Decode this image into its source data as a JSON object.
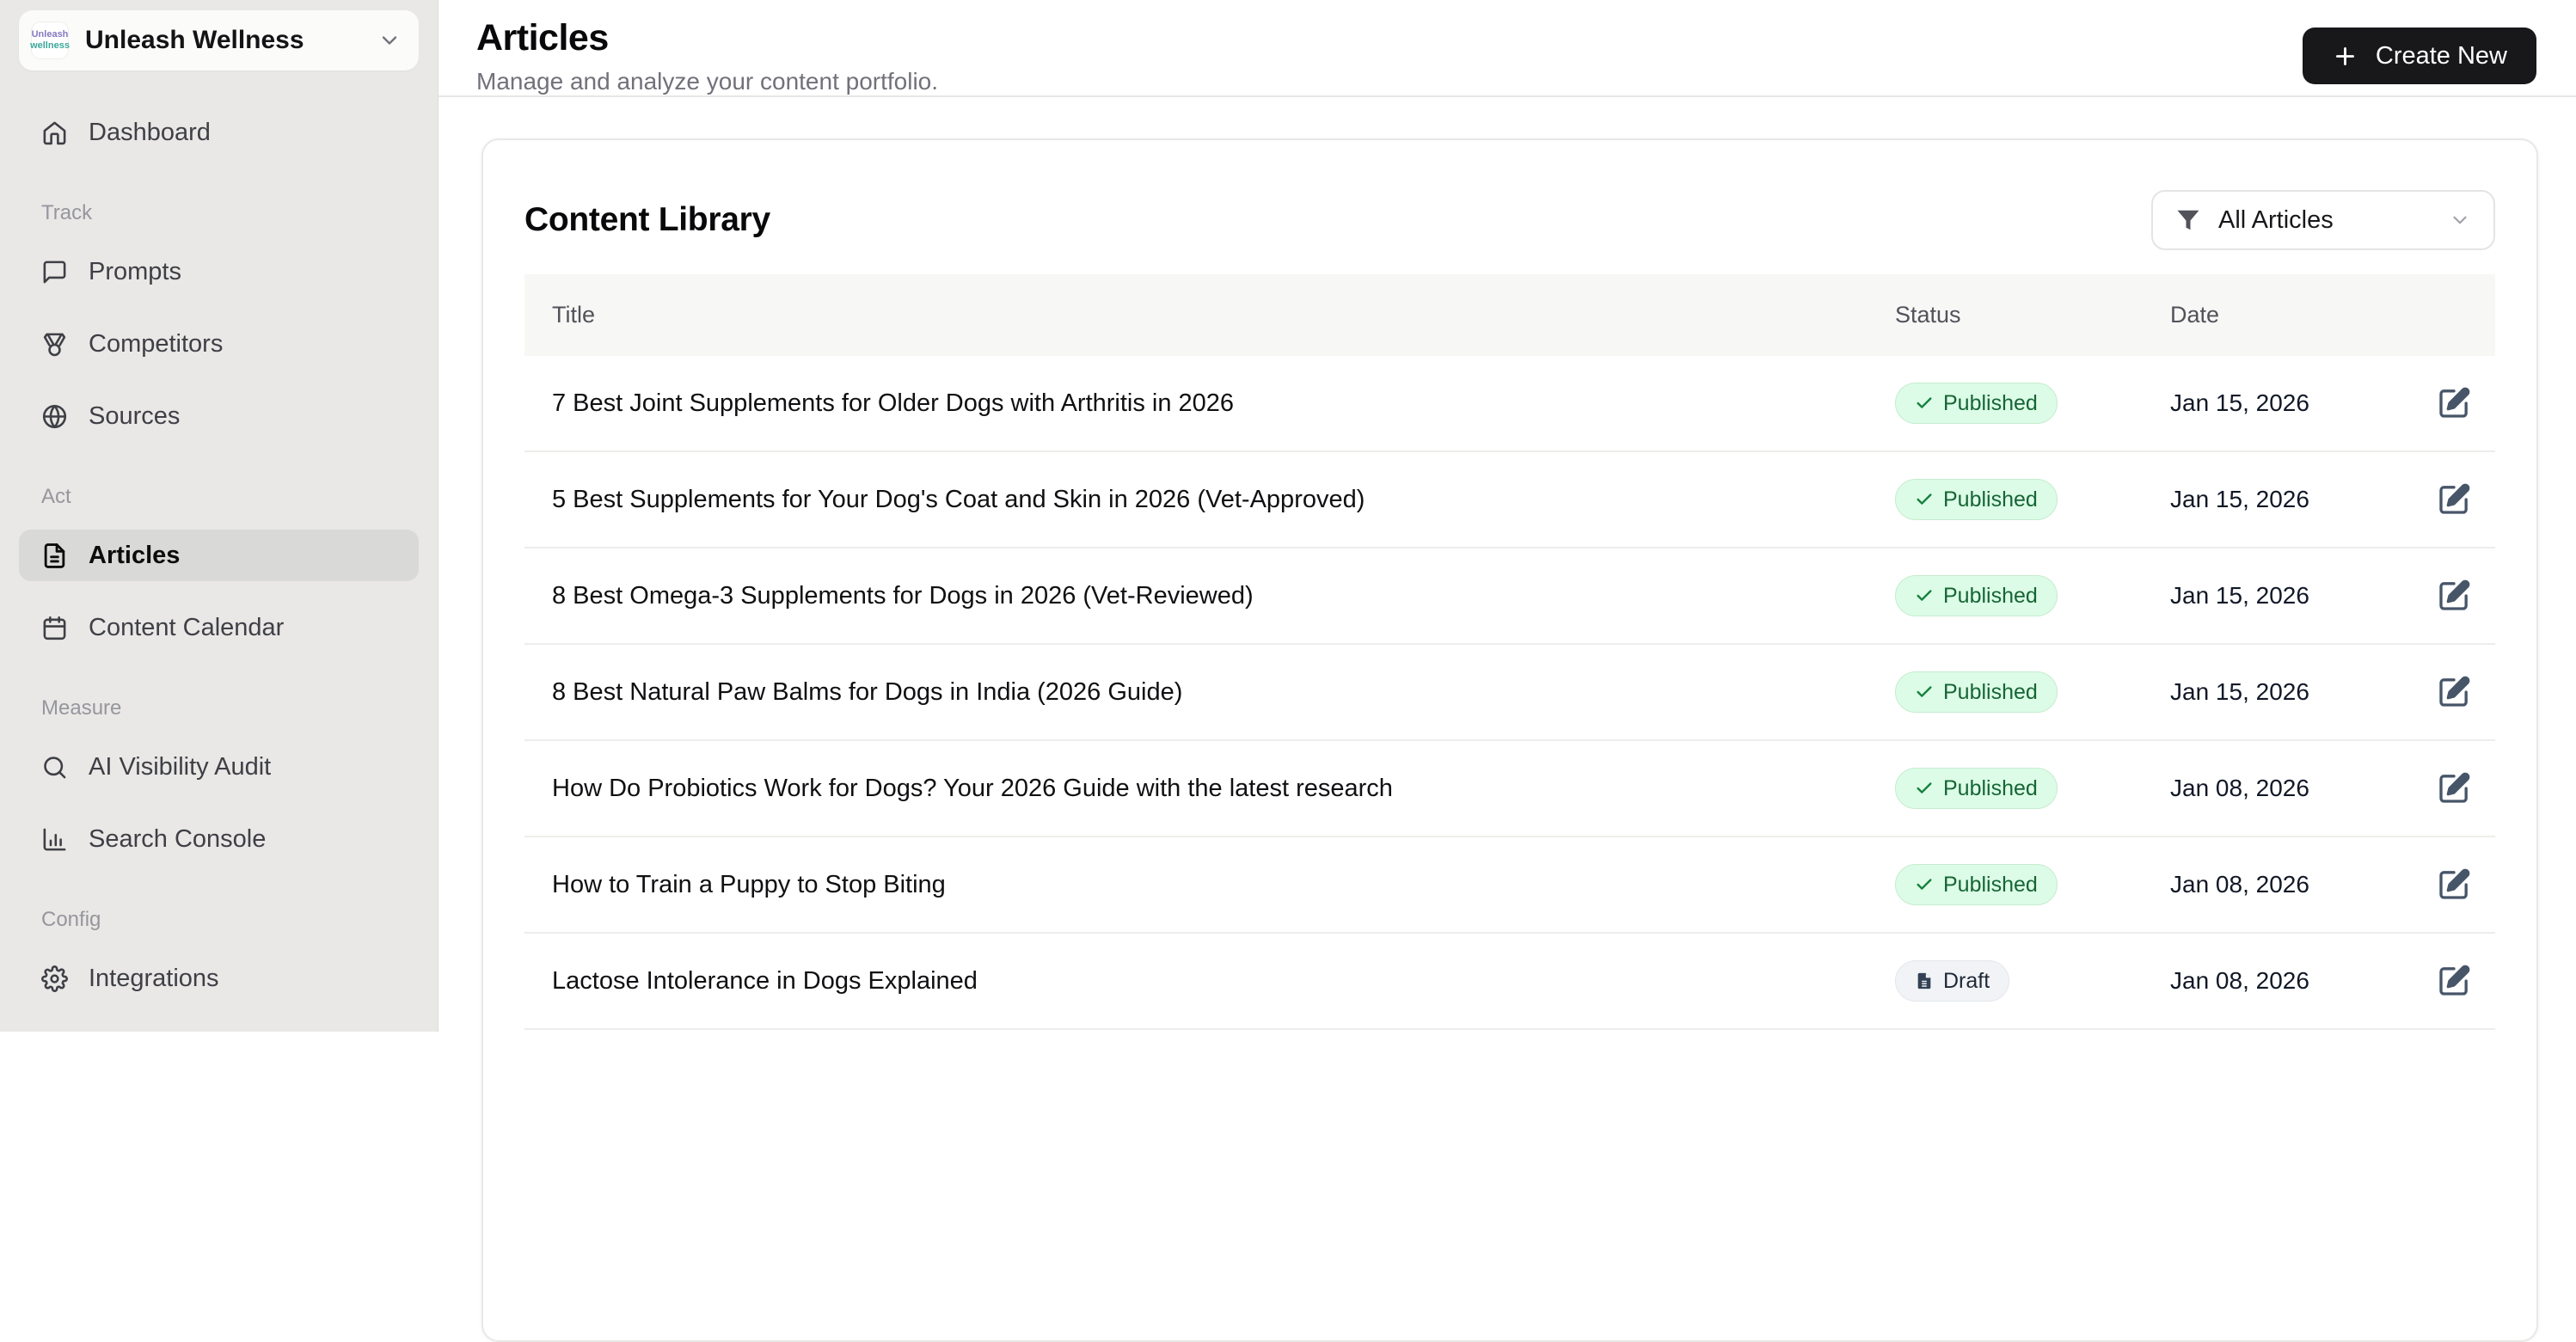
{
  "workspace": {
    "name": "Unleash Wellness",
    "logo_line1": "Unleash",
    "logo_line2": "wellness"
  },
  "sidebar": {
    "groups": [
      {
        "label": "",
        "items": [
          {
            "label": "Dashboard",
            "icon": "home",
            "active": false
          }
        ]
      },
      {
        "label": "Track",
        "items": [
          {
            "label": "Prompts",
            "icon": "message",
            "active": false
          },
          {
            "label": "Competitors",
            "icon": "medal",
            "active": false
          },
          {
            "label": "Sources",
            "icon": "globe",
            "active": false
          }
        ]
      },
      {
        "label": "Act",
        "items": [
          {
            "label": "Articles",
            "icon": "file-text",
            "active": true
          },
          {
            "label": "Content Calendar",
            "icon": "calendar",
            "active": false
          }
        ]
      },
      {
        "label": "Measure",
        "items": [
          {
            "label": "AI Visibility Audit",
            "icon": "search",
            "active": false
          },
          {
            "label": "Search Console",
            "icon": "bar-chart",
            "active": false
          }
        ]
      },
      {
        "label": "Config",
        "items": [
          {
            "label": "Integrations",
            "icon": "settings",
            "active": false
          }
        ]
      }
    ]
  },
  "header": {
    "title": "Articles",
    "subtitle": "Manage and analyze your content portfolio.",
    "create_button_label": "Create New"
  },
  "library": {
    "title": "Content Library",
    "filter_label": "All Articles",
    "columns": {
      "title": "Title",
      "status": "Status",
      "date": "Date"
    },
    "rows": [
      {
        "title": "7 Best Joint Supplements for Older Dogs with Arthritis in 2026",
        "status": "Published",
        "date": "Jan 15, 2026"
      },
      {
        "title": "5 Best Supplements for Your Dog's Coat and Skin in 2026 (Vet-Approved)",
        "status": "Published",
        "date": "Jan 15, 2026"
      },
      {
        "title": "8 Best Omega-3 Supplements for Dogs in 2026 (Vet-Reviewed)",
        "status": "Published",
        "date": "Jan 15, 2026"
      },
      {
        "title": "8 Best Natural Paw Balms for Dogs in India (2026 Guide)",
        "status": "Published",
        "date": "Jan 15, 2026"
      },
      {
        "title": "How Do Probiotics Work for Dogs? Your 2026 Guide with the latest research",
        "status": "Published",
        "date": "Jan 08, 2026"
      },
      {
        "title": "How to Train a Puppy to Stop Biting",
        "status": "Published",
        "date": "Jan 08, 2026"
      },
      {
        "title": "Lactose Intolerance in Dogs Explained",
        "status": "Draft",
        "date": "Jan 08, 2026"
      }
    ]
  },
  "colors": {
    "sidebar_bg": "#e9e8e6",
    "active_item_bg": "#d9d9d7",
    "accent_dark": "#18181b",
    "published_bg": "#dcfce7",
    "published_text": "#166534",
    "draft_bg": "#f1f3f6",
    "draft_text": "#1f2937"
  }
}
